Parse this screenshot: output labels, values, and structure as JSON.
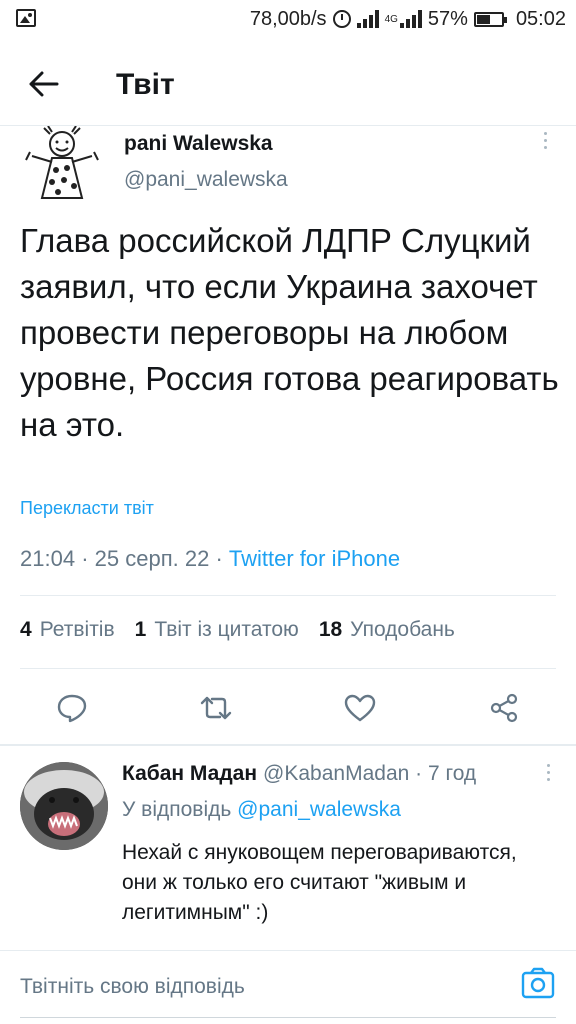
{
  "status_bar": {
    "speed": "78,00b/s",
    "network": "4G",
    "battery_percent_text": "57%",
    "battery_level": 0.57,
    "time": "05:02",
    "icons": [
      "image-icon",
      "alarm-icon",
      "signal-icon",
      "battery-icon"
    ]
  },
  "header": {
    "title": "Твіт",
    "back_icon": "arrow-left-icon"
  },
  "tweet": {
    "author_name": "pani Walewska",
    "author_handle": "@pani_walewska",
    "text": "Глава российской ЛДПР Слуцкий заявил, что если Украина захочет провести переговоры на любом уровне, Россия готова реагировать на это.",
    "translate_label": "Перекласти твіт",
    "time": "21:04",
    "date": "25 серп. 22",
    "source": "Twitter for iPhone",
    "stats": {
      "retweets_count": "4",
      "retweets_label": "Ретвітів",
      "quotes_count": "1",
      "quotes_label": "Твіт із цитатою",
      "likes_count": "18",
      "likes_label": "Уподобань"
    }
  },
  "reply": {
    "author_name": "Кабан Мадан",
    "author_handle": "@KabanMadan",
    "time_ago": "7 год",
    "reply_to_label": "У відповідь",
    "reply_to_handle": "@pani_walewska",
    "text": "Нехай с януковощем переговариваются, они ж только его считают \"живым и легитимным\" :)"
  },
  "composer": {
    "placeholder": "Твітніть свою відповідь"
  },
  "colors": {
    "accent": "#1da1f2",
    "secondary_text": "#657786",
    "primary_text": "#14171a",
    "divider": "#e6ecf0"
  }
}
